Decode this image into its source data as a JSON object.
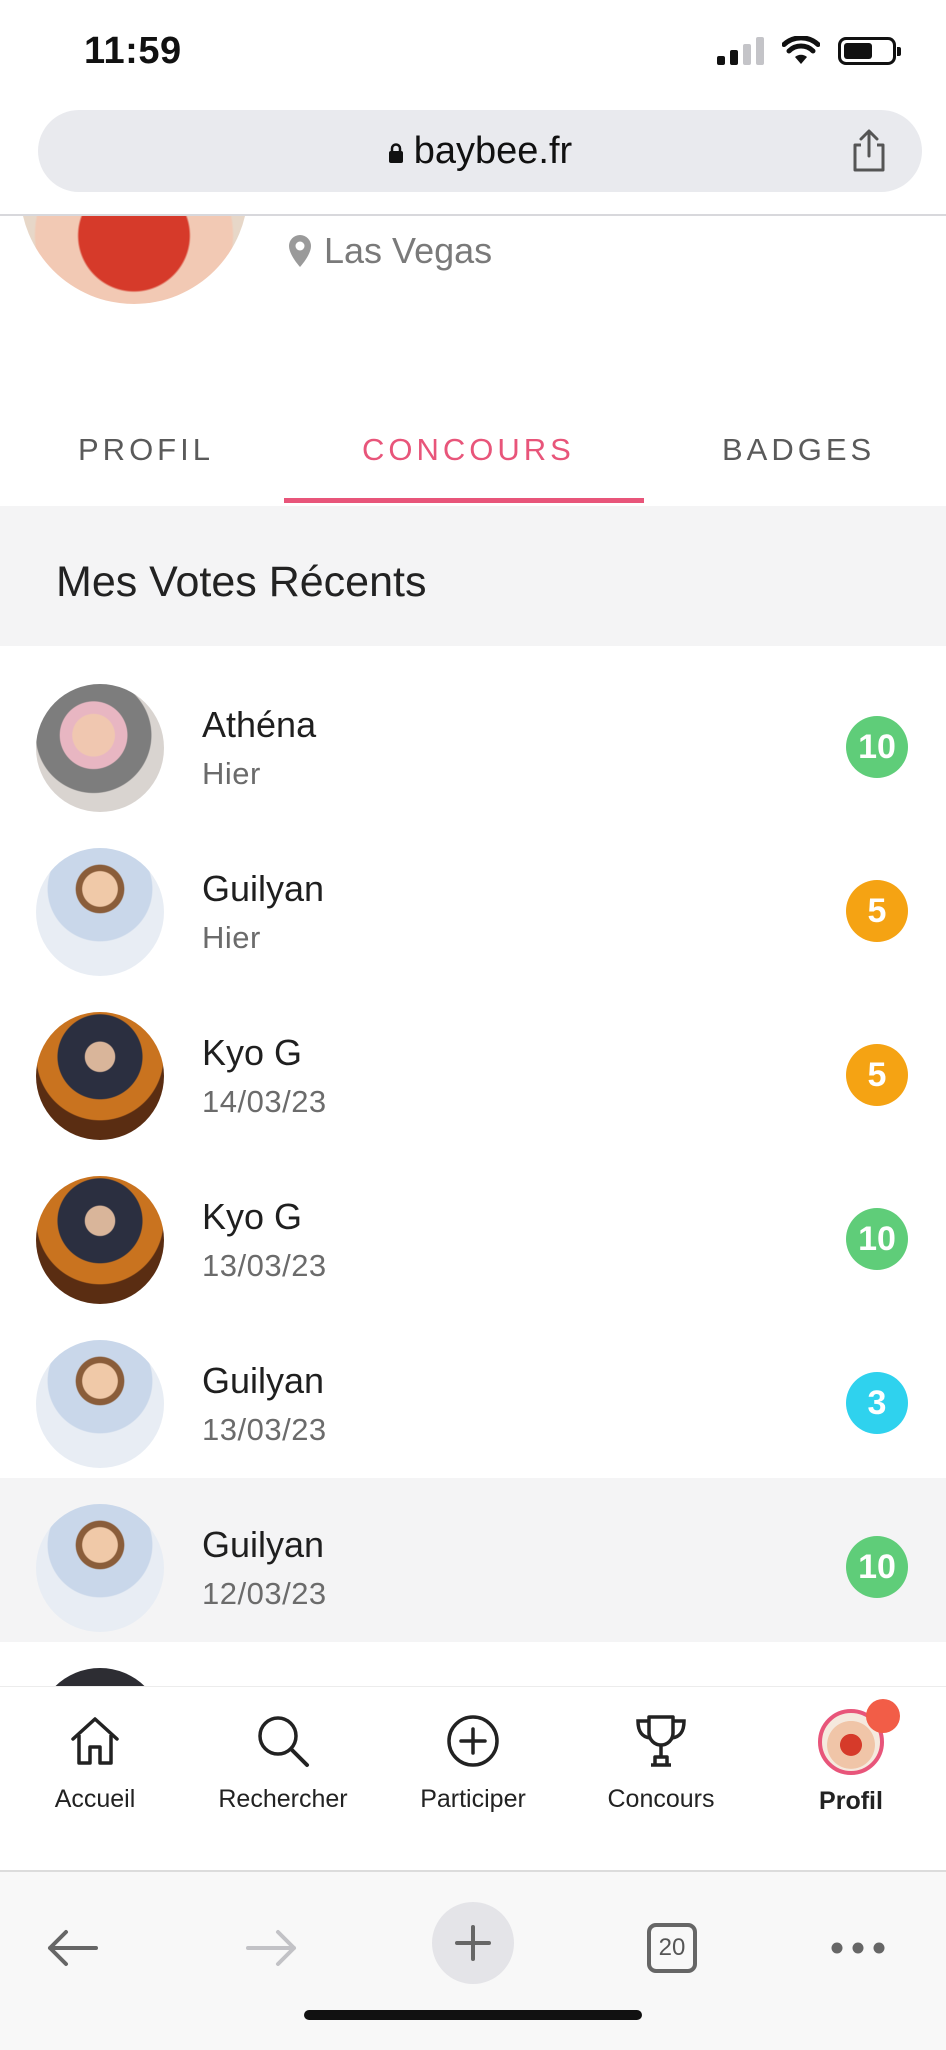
{
  "status_bar": {
    "time": "11:59"
  },
  "browser": {
    "url": "baybee.fr"
  },
  "profile": {
    "location": "Las Vegas"
  },
  "tabs": [
    {
      "label": "PROFIL",
      "active": false
    },
    {
      "label": "CONCOURS",
      "active": true
    },
    {
      "label": "BADGES",
      "active": false
    }
  ],
  "section": {
    "title": "Mes Votes Récents"
  },
  "votes": [
    {
      "name": "Athéna",
      "date": "Hier",
      "points": "10",
      "color": "#5fcd79"
    },
    {
      "name": "Guilyan",
      "date": "Hier",
      "points": "5",
      "color": "#f5a313"
    },
    {
      "name": "Kyo G",
      "date": "14/03/23",
      "points": "5",
      "color": "#f5a313"
    },
    {
      "name": "Kyo G",
      "date": "13/03/23",
      "points": "10",
      "color": "#5fcd79"
    },
    {
      "name": "Guilyan",
      "date": "13/03/23",
      "points": "3",
      "color": "#2fd2ee"
    },
    {
      "name": "Guilyan",
      "date": "12/03/23",
      "points": "10",
      "color": "#5fcd79"
    }
  ],
  "bottom_nav": [
    {
      "label": "Accueil",
      "icon": "home-icon"
    },
    {
      "label": "Rechercher",
      "icon": "search-icon"
    },
    {
      "label": "Participer",
      "icon": "plus-circle-icon"
    },
    {
      "label": "Concours",
      "icon": "trophy-icon"
    },
    {
      "label": "Profil",
      "icon": "avatar",
      "active": true
    }
  ],
  "safari": {
    "tab_count": "20"
  },
  "colors": {
    "accent": "#e8557a",
    "green": "#5fcd79",
    "orange": "#f5a313",
    "cyan": "#2fd2ee"
  }
}
